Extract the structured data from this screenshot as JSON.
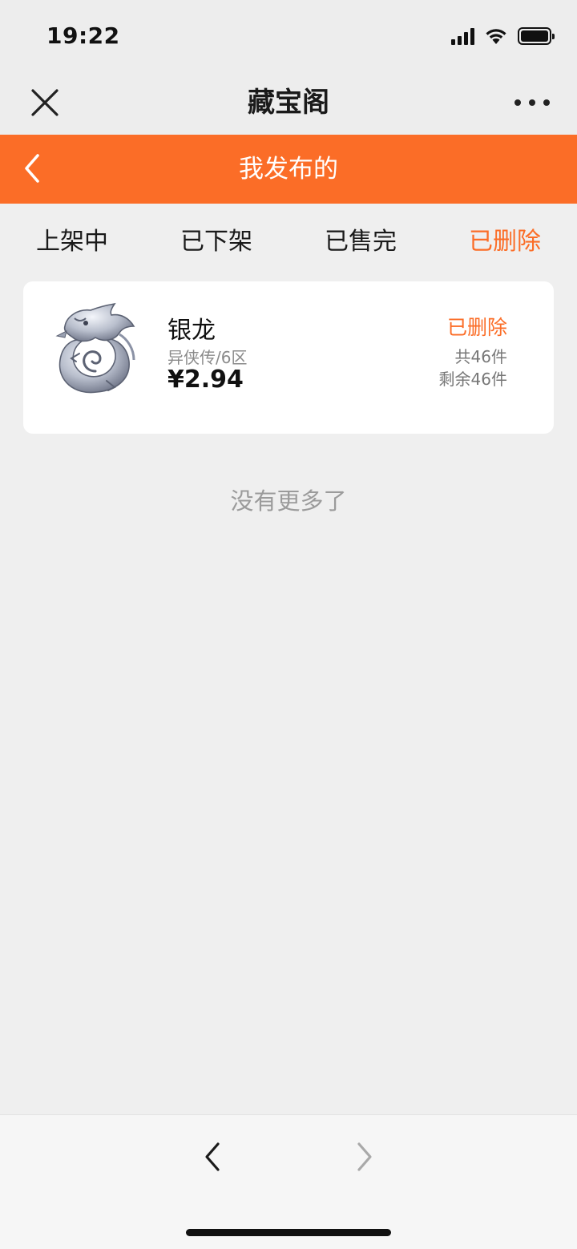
{
  "status_bar": {
    "time": "19:22"
  },
  "mini_program": {
    "title": "藏宝阁"
  },
  "header": {
    "title": "我发布的"
  },
  "tabs": [
    {
      "label": "上架中",
      "active": false
    },
    {
      "label": "已下架",
      "active": false
    },
    {
      "label": "已售完",
      "active": false
    },
    {
      "label": "已删除",
      "active": true
    }
  ],
  "items": [
    {
      "name": "银龙",
      "server": "异侠传/6区",
      "price": "¥2.94",
      "status": "已删除",
      "total": "共46件",
      "remaining": "剩余46件",
      "image_icon": "silver-dragon-icon"
    }
  ],
  "list_end_text": "没有更多了",
  "colors": {
    "accent": "#fb6d27",
    "background": "#efefef",
    "card": "#ffffff",
    "muted_text": "#8a8a8a"
  }
}
